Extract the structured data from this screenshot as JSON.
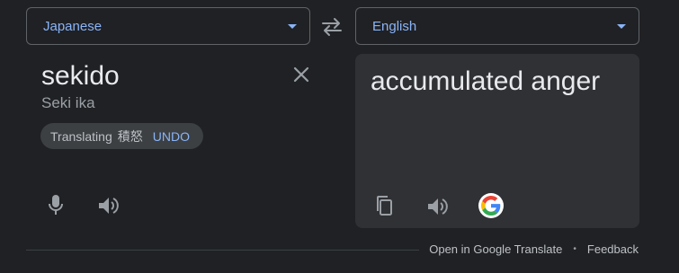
{
  "source": {
    "language": "Japanese",
    "text": "sekido",
    "transliteration": "Seki ika",
    "chip": {
      "status": "Translating",
      "word": "積怒",
      "undo_label": "UNDO"
    }
  },
  "target": {
    "language": "English",
    "text": "accumulated anger"
  },
  "footer": {
    "open_link": "Open in Google Translate",
    "separator": "•",
    "feedback_link": "Feedback"
  },
  "icons": {
    "swap": "swap-arrows-icon",
    "clear": "close-icon",
    "mic": "microphone-icon",
    "speaker": "speaker-icon",
    "copy": "copy-icon",
    "google": "google-g-logo"
  },
  "colors": {
    "background": "#202124",
    "panel": "#303134",
    "accent": "#8ab4f8",
    "text": "#e8eaed",
    "muted": "#9aa0a6"
  }
}
